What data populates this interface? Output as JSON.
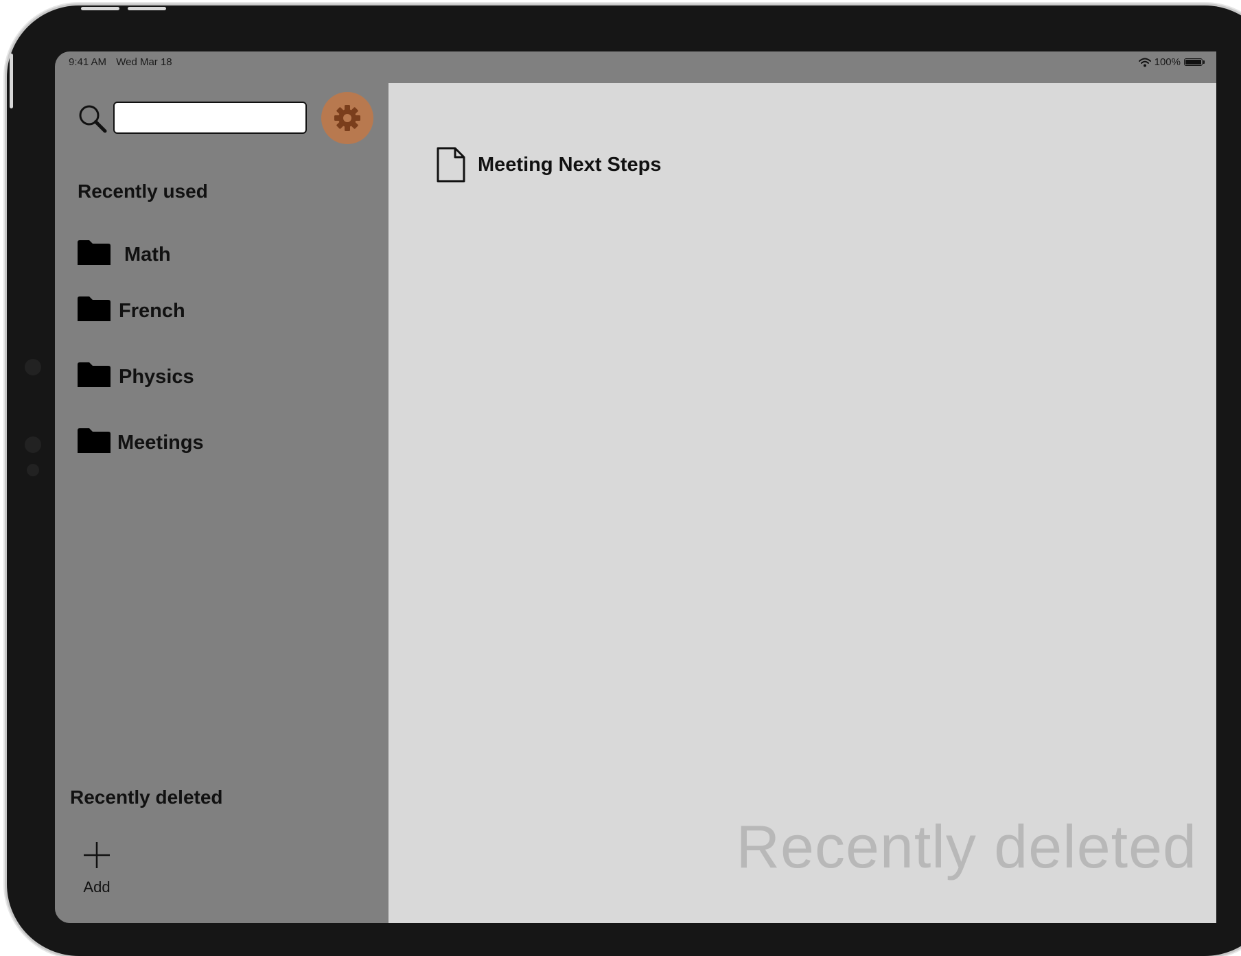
{
  "status_bar": {
    "time": "9:41 AM",
    "date": "Wed Mar 18",
    "battery": "100%"
  },
  "sidebar": {
    "search": {
      "value": "",
      "placeholder": ""
    },
    "settings_icon": "gear-icon",
    "settings_color": "#b8794f",
    "recently_used_heading": "Recently used",
    "folders": [
      {
        "label": "Math",
        "icon": "folder-icon"
      },
      {
        "label": "French",
        "icon": "folder-icon"
      },
      {
        "label": "Physics",
        "icon": "folder-icon"
      },
      {
        "label": "Meetings",
        "icon": "folder-icon"
      }
    ],
    "recently_deleted_heading": "Recently deleted",
    "add_label": "Add"
  },
  "main": {
    "documents": [
      {
        "label": "Meeting Next Steps",
        "icon": "document-icon"
      }
    ],
    "watermark": "Recently deleted"
  },
  "colors": {
    "sidebar_bg": "#808080",
    "main_bg": "#d9d9d9",
    "watermark": "#b8b8b8"
  }
}
